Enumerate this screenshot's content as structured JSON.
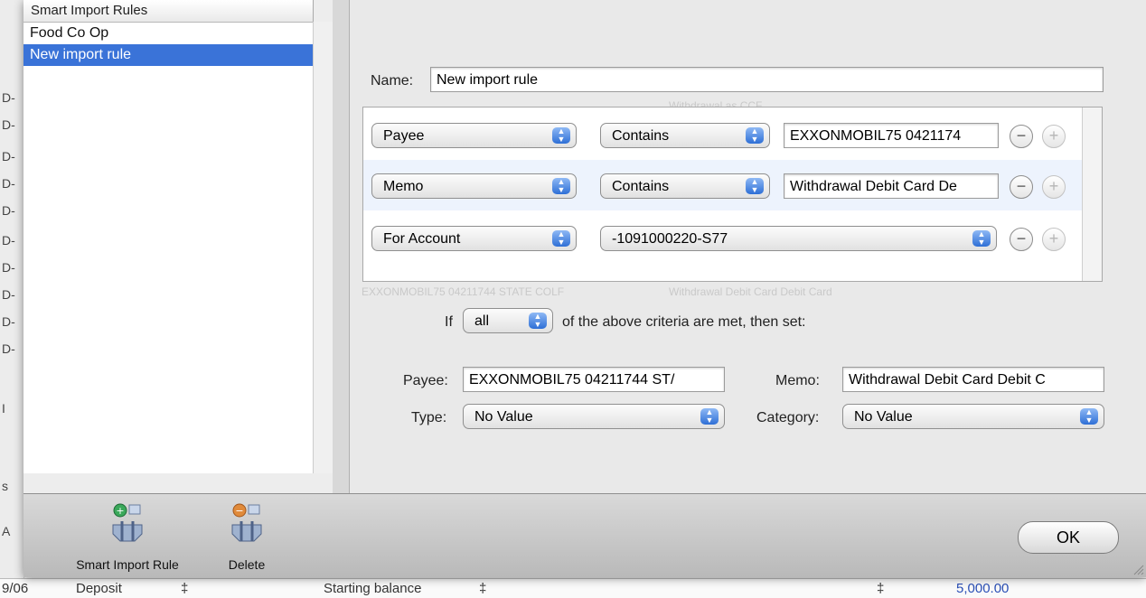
{
  "list": {
    "header": "Smart Import Rules",
    "items": [
      {
        "label": "Food Co Op",
        "selected": false
      },
      {
        "label": "New import rule",
        "selected": true
      }
    ]
  },
  "rule": {
    "name_label": "Name:",
    "name_value": "New import rule",
    "criteria": [
      {
        "field": "Payee",
        "operator": "Contains",
        "value": "EXXONMOBIL75 0421174"
      },
      {
        "field": "Memo",
        "operator": "Contains",
        "value": "Withdrawal Debit Card De"
      },
      {
        "field": "For Account",
        "account": "-1091000220-S77"
      }
    ],
    "if_label": "If",
    "match_value": "all",
    "match_suffix": "of the above criteria are met, then set:",
    "payee_label": "Payee:",
    "payee_value": "EXXONMOBIL75 04211744 ST/",
    "memo_label": "Memo:",
    "memo_value": "Withdrawal Debit Card Debit C",
    "type_label": "Type:",
    "type_value": "No Value",
    "category_label": "Category:",
    "category_value": "No Value"
  },
  "toolbar": {
    "add_label": "Smart Import Rule",
    "delete_label": "Delete",
    "ok_label": "OK"
  },
  "background": {
    "row_date": "9/06",
    "row_type": "Deposit",
    "row_desc": "Starting balance",
    "row_amount": "5,000.00"
  },
  "colors": {
    "selection": "#3a73d8",
    "alt_row": "#edf3fd"
  }
}
